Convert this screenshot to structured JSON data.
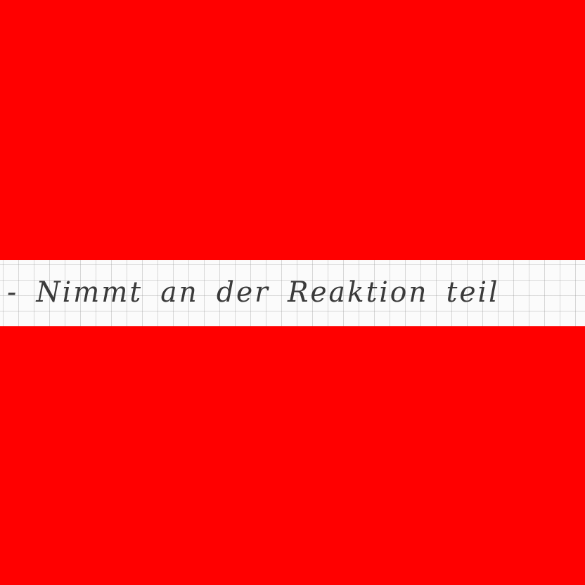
{
  "page": {
    "background_color": "#ff0000"
  },
  "note": {
    "paper": "grid-paper",
    "text": "- Nimmt an der Reaktion teil"
  }
}
